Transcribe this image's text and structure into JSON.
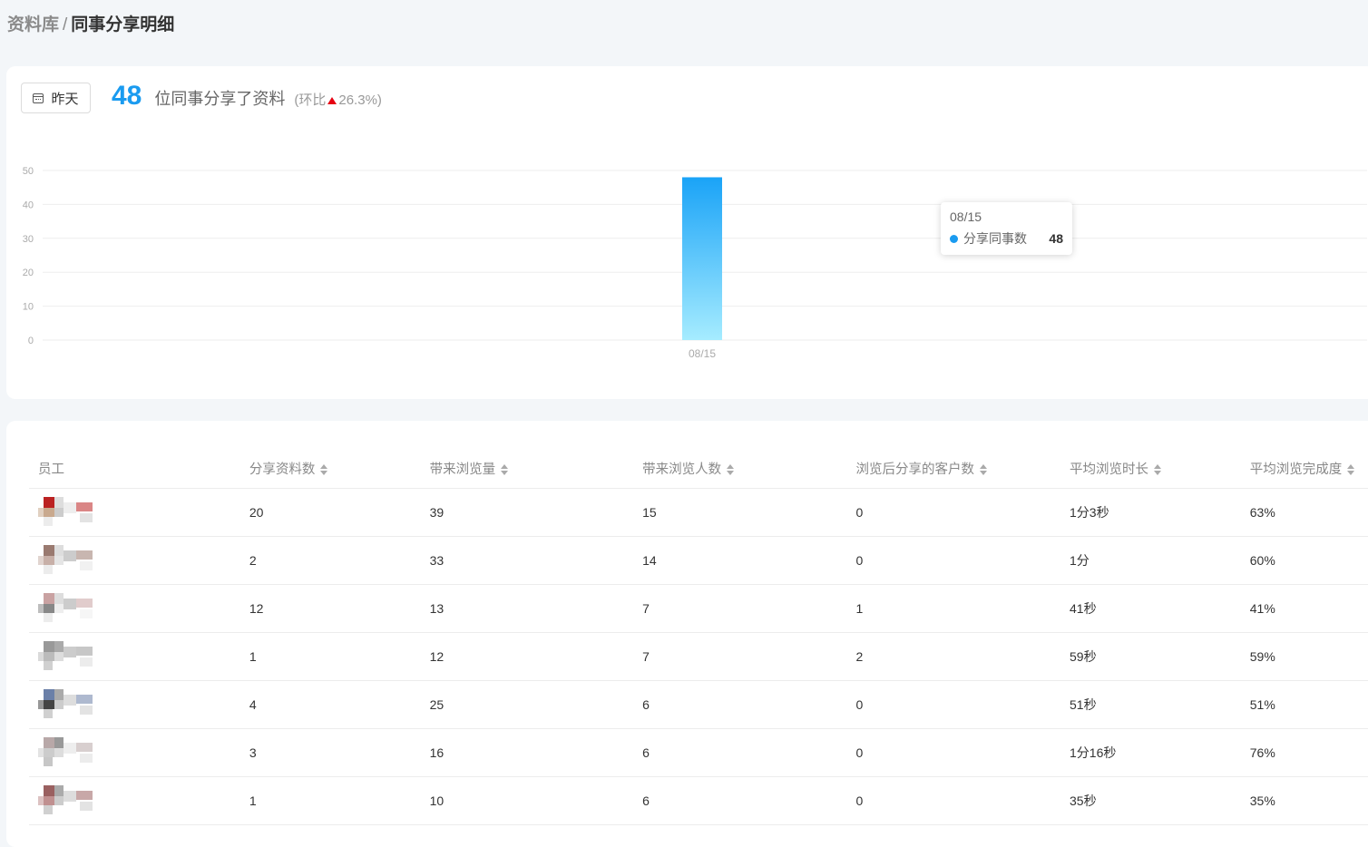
{
  "breadcrumb": {
    "parent": "资料库",
    "separator": "/",
    "current": "同事分享明细"
  },
  "filter": {
    "date_label": "昨天"
  },
  "summary": {
    "count": "48",
    "text": "位同事分享了资料",
    "ratio_prefix": "(环比",
    "ratio_value": "26.3%)"
  },
  "tooltip": {
    "date": "08/15",
    "label": "分享同事数",
    "value": "48"
  },
  "chart_data": {
    "type": "bar",
    "categories": [
      "08/15"
    ],
    "series": [
      {
        "name": "分享同事数",
        "values": [
          48
        ]
      }
    ],
    "ylim": [
      0,
      50
    ],
    "yticks": [
      0,
      10,
      20,
      30,
      40,
      50
    ],
    "grid": true,
    "colors": {
      "bar_top": "#1aa3f7",
      "bar_bottom": "#a6ecff"
    }
  },
  "table": {
    "columns": [
      "员工",
      "分享资料数",
      "带来浏览量",
      "带来浏览人数",
      "浏览后分享的客户数",
      "平均浏览时长",
      "平均浏览完成度"
    ],
    "rows": [
      [
        "",
        "20",
        "39",
        "15",
        "0",
        "1分3秒",
        "63%"
      ],
      [
        "",
        "2",
        "33",
        "14",
        "0",
        "1分",
        "60%"
      ],
      [
        "",
        "12",
        "13",
        "7",
        "1",
        "41秒",
        "41%"
      ],
      [
        "",
        "1",
        "12",
        "7",
        "2",
        "59秒",
        "59%"
      ],
      [
        "",
        "4",
        "25",
        "6",
        "0",
        "51秒",
        "51%"
      ],
      [
        "",
        "3",
        "16",
        "6",
        "0",
        "1分16秒",
        "76%"
      ],
      [
        "",
        "1",
        "10",
        "6",
        "0",
        "35秒",
        "35%"
      ]
    ]
  }
}
